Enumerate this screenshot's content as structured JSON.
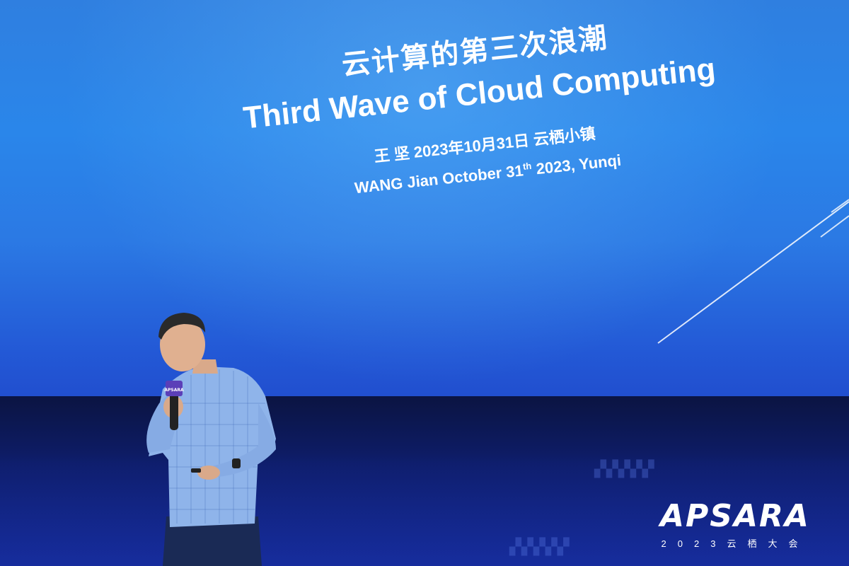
{
  "screen": {
    "title_cn": "云计算的第三次浪潮",
    "title_en": "Third Wave of Cloud Computing",
    "subtitle_cn": "王 坚  2023年10月31日 云栖小镇",
    "subtitle_en_prefix": "WANG Jian October 31",
    "subtitle_en_sup": "th",
    "subtitle_en_suffix": " 2023, Yunqi"
  },
  "logo": {
    "wordmark": "APSARA",
    "tagline": "2023云栖大会"
  },
  "microphone": {
    "label": "APSARA"
  },
  "colors": {
    "screen_top": "#2f7fe0",
    "screen_bottom": "#1f45c8",
    "floor": "#0e1d6a",
    "shirt": "#8fb4ea",
    "pants": "#1a2a55"
  }
}
